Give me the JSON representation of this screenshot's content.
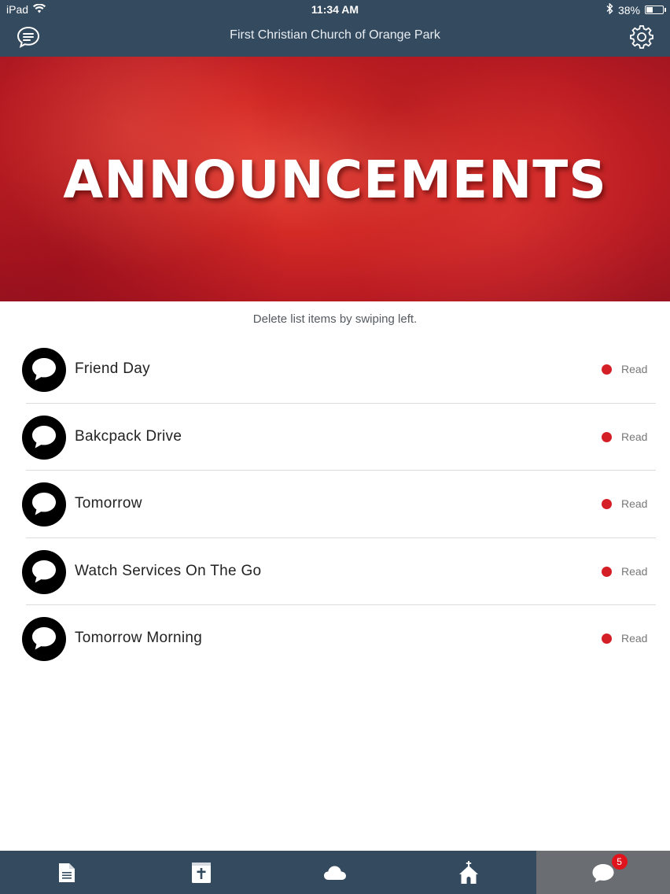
{
  "status_bar": {
    "device": "iPad",
    "time": "11:34 AM",
    "battery": "38%",
    "battery_level": 0.38
  },
  "header": {
    "title": "First Christian Church of Orange Park",
    "left_icon": "chat-lines-icon",
    "right_icon": "gear-icon"
  },
  "banner": {
    "headline": "ANNOUNCEMENTS"
  },
  "hint": "Delete list items by swiping left.",
  "announcements": [
    {
      "title": "Friend Day",
      "status": "Read"
    },
    {
      "title": "Bakcpack Drive",
      "status": "Read"
    },
    {
      "title": "Tomorrow",
      "status": "Read"
    },
    {
      "title": "Watch Services On The Go",
      "status": "Read"
    },
    {
      "title": "Tomorrow Morning",
      "status": "Read"
    }
  ],
  "tabbar": {
    "tabs": [
      {
        "icon": "document-icon"
      },
      {
        "icon": "bible-icon"
      },
      {
        "icon": "cloud-icon"
      },
      {
        "icon": "church-icon"
      },
      {
        "icon": "chat-bubble-icon",
        "badge": "5",
        "active": true
      }
    ]
  },
  "colors": {
    "header_bg": "#344a5e",
    "accent_red": "#d41f26",
    "active_tab_bg": "#6a6d72"
  }
}
